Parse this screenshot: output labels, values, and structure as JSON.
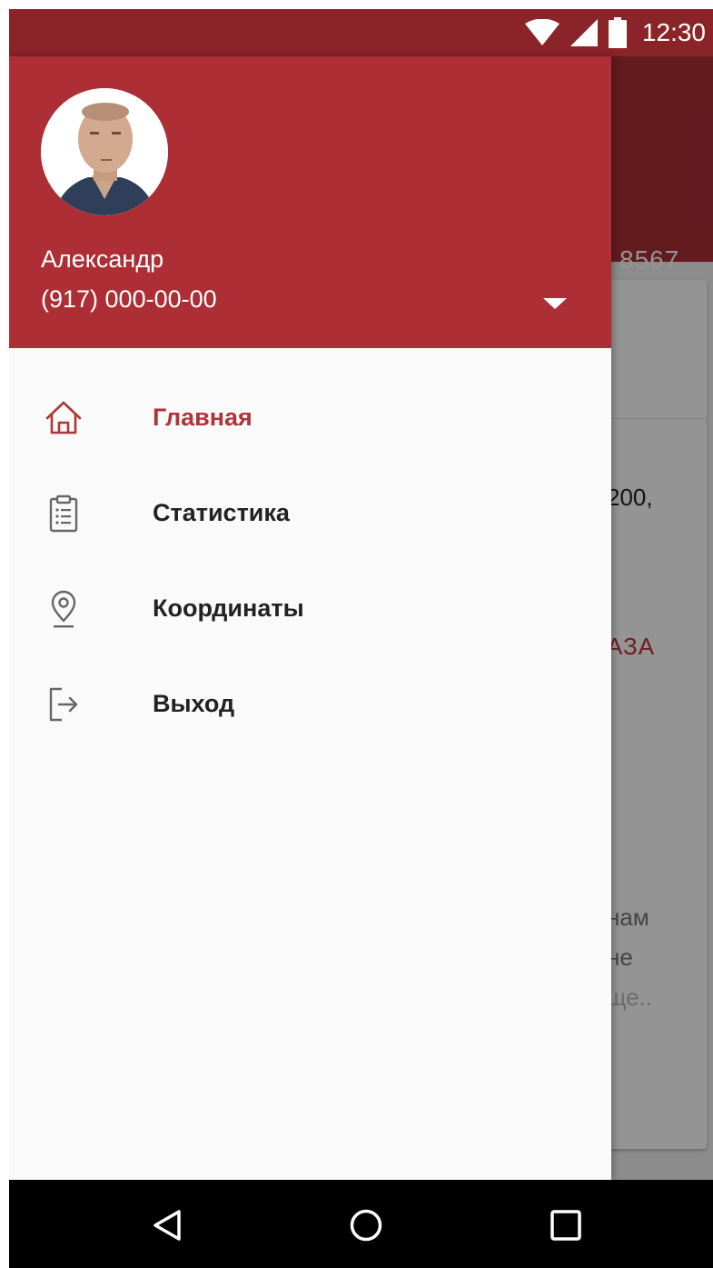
{
  "status_bar": {
    "time": "12:30",
    "icons": [
      "wifi-icon",
      "cell-signal-icon",
      "battery-icon"
    ]
  },
  "background": {
    "appbar_number": "8567",
    "card_lines": [
      "200,",
      "АЗА",
      "нам",
      "не",
      "ще.."
    ]
  },
  "drawer": {
    "header": {
      "user_name": "Александр",
      "user_phone": "(917) 000-00-00"
    },
    "menu": [
      {
        "label": "Главная",
        "icon": "home-icon",
        "active": true
      },
      {
        "label": "Статистика",
        "icon": "clipboard-list-icon",
        "active": false
      },
      {
        "label": "Координаты",
        "icon": "location-pin-icon",
        "active": false
      },
      {
        "label": "Выход",
        "icon": "logout-icon",
        "active": false
      }
    ]
  },
  "nav_bar": {
    "buttons": [
      "back-icon",
      "home-circle-icon",
      "recents-square-icon"
    ]
  },
  "colors": {
    "primary": "#ad2f35",
    "primary_dark": "#8b2429",
    "accent_text": "#b0343a",
    "drawer_bg": "#fafafa"
  }
}
